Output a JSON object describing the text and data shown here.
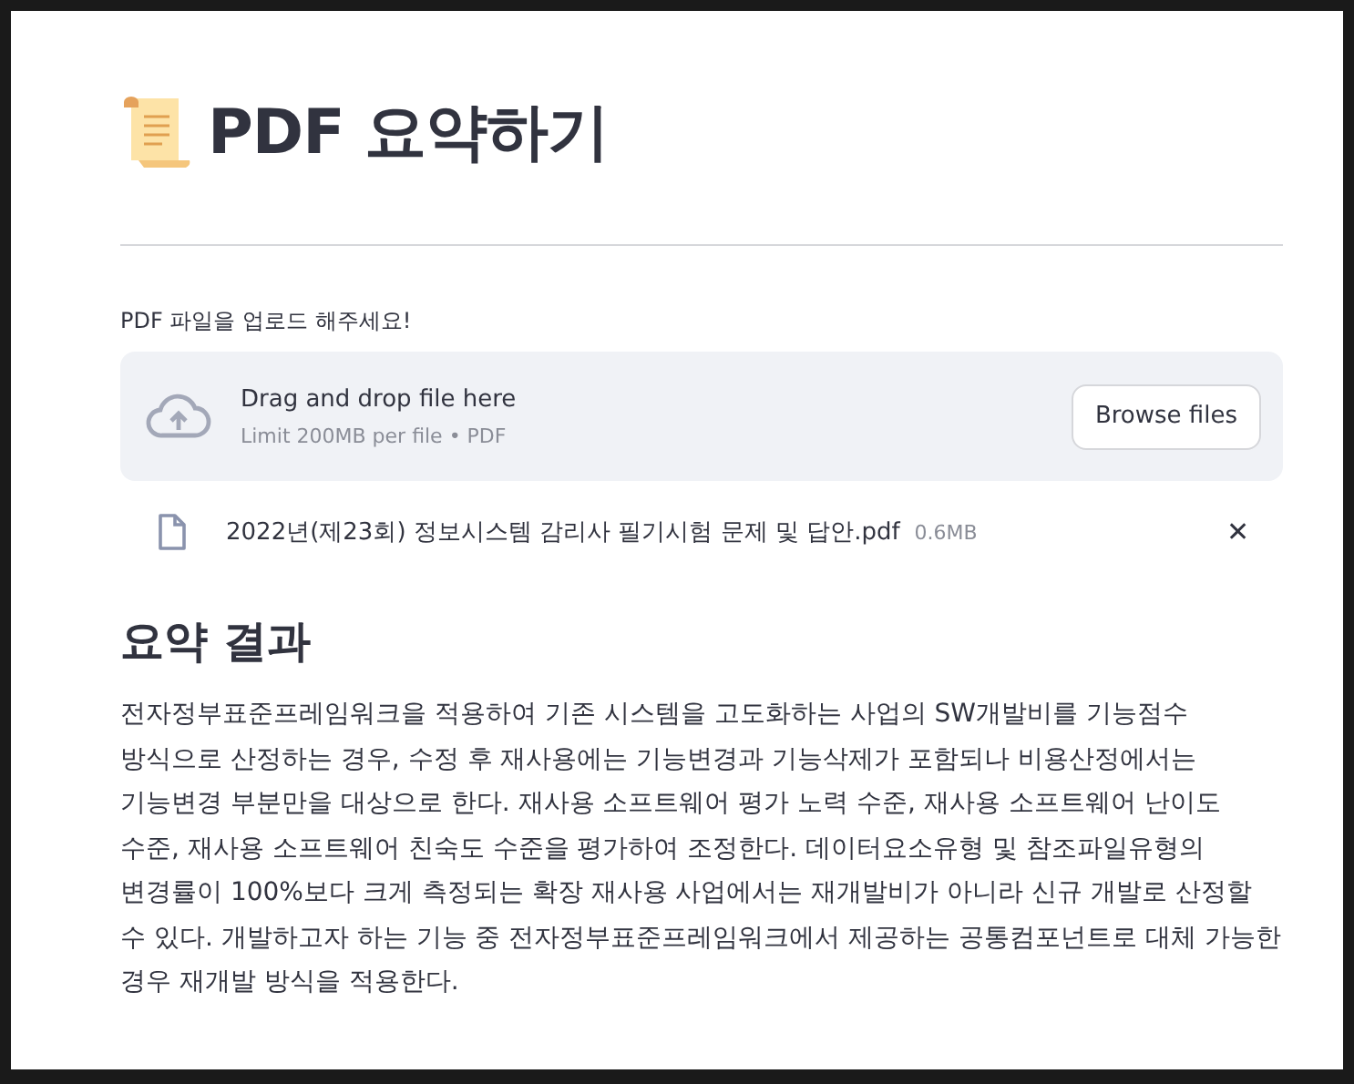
{
  "title": "PDF 요약하기",
  "uploader": {
    "label": "PDF 파일을 업로드 해주세요!",
    "dropzone_text": "Drag and drop file here",
    "limit_text": "Limit 200MB per file • PDF",
    "browse_button": "Browse files",
    "files": [
      {
        "name": "2022년(제23회) 정보시스템 감리사 필기시험 문제 및 답안.pdf",
        "size": "0.6MB",
        "remove": "✕"
      }
    ]
  },
  "result": {
    "heading": "요약 결과",
    "text": "전자정부표준프레임워크을 적용하여 기존 시스템을 고도화하는 사업의 SW개발비를 기능점수 방식으로 산정하는 경우, 수정 후 재사용에는 기능변경과 기능삭제가 포함되나 비용산정에서는 기능변경 부분만을 대상으로 한다. 재사용 소프트웨어 평가 노력 수준, 재사용 소프트웨어 난이도 수준, 재사용 소프트웨어 친숙도 수준을 평가하여 조정한다. 데이터요소유형 및 참조파일유형의 변경률이 100%보다 크게 측정되는 확장 재사용 사업에서는 재개발비가 아니라 신규 개발로 산정할 수 있다. 개발하고자 하는 기능 중 전자정부표준프레임워크에서 제공하는 공통컴포넌트로 대체 가능한 경우 재개발 방식을 적용한다."
  }
}
